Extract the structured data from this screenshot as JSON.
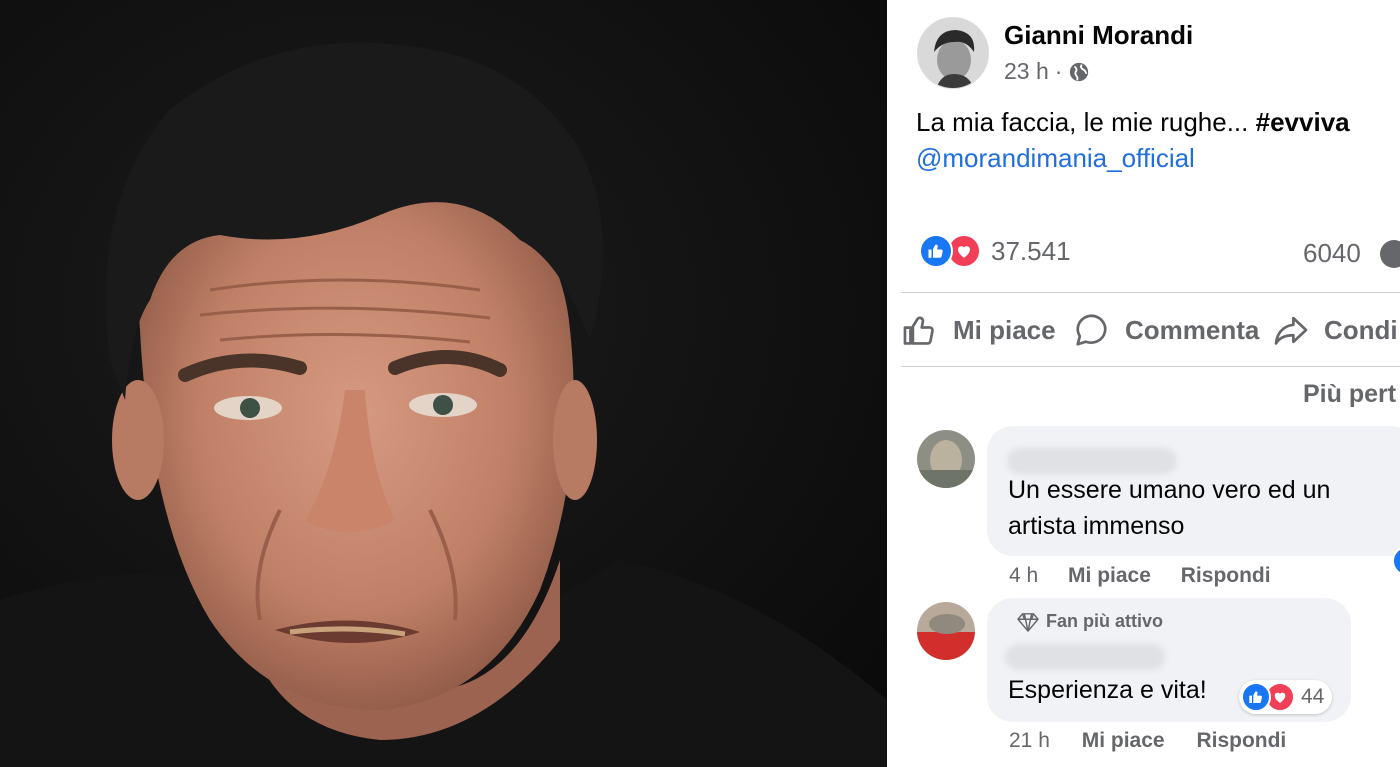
{
  "post": {
    "author": "Gianni Morandi",
    "time": "23 h",
    "separator": "·",
    "text": "La mia faccia, le mie rughe...",
    "hashtag": "#evviva",
    "mention": "@morandimania_official"
  },
  "stats": {
    "reactions_count": "37.541",
    "comments_count": "6040"
  },
  "actions": {
    "like_label": "Mi piace",
    "comment_label": "Commenta",
    "share_label": "Condi"
  },
  "comments_sort": "Più pert",
  "comments": [
    {
      "text_line1": "Un essere umano vero ed un",
      "text_line2": "artista immenso",
      "time": "4 h",
      "like_label": "Mi piace",
      "reply_label": "Rispondi"
    },
    {
      "badge": "Fan più attivo",
      "text_line1": "Esperienza e vita!",
      "reactions_count": "44",
      "time": "21 h",
      "like_label": "Mi piace",
      "reply_label": "Rispondi"
    }
  ],
  "colors": {
    "link": "#216fdb",
    "like_blue": "#1877f2",
    "love_red": "#f33e58",
    "secondary_text": "#65676b",
    "bubble_bg": "#f0f2f5"
  },
  "icons": [
    "globe-icon",
    "like-icon",
    "love-icon",
    "thumbs-up-outline-icon",
    "comment-bubble-icon",
    "share-arrow-icon",
    "diamond-icon"
  ]
}
